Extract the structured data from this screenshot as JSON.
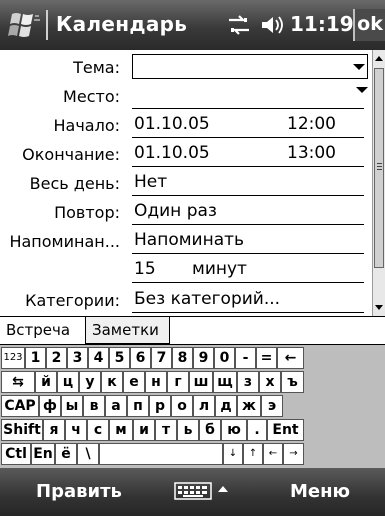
{
  "titlebar": {
    "title": "Календарь",
    "time": "11:19",
    "ok_label": "ok",
    "icons": [
      "windows-start-icon",
      "connectivity-icon",
      "volume-icon"
    ]
  },
  "form": {
    "subject": {
      "label": "Тема:",
      "value": ""
    },
    "location": {
      "label": "Место:",
      "value": ""
    },
    "starts": {
      "label": "Начало:",
      "date": "01.10.05",
      "time": "12:00"
    },
    "ends": {
      "label": "Окончание:",
      "date": "01.10.05",
      "time": "13:00"
    },
    "all_day": {
      "label": "Весь день:",
      "value": "Нет"
    },
    "occurs": {
      "label": "Повтор:",
      "value": "Один раз"
    },
    "reminder": {
      "label": "Напоминан...",
      "value": "Напоминать"
    },
    "reminder_time": {
      "amount": "15",
      "unit": "минут"
    },
    "categories": {
      "label": "Категории:",
      "value": "Без категорий..."
    }
  },
  "tabs": [
    {
      "label": "Встреча",
      "active": true
    },
    {
      "label": "Заметки",
      "active": false
    }
  ],
  "keyboard": {
    "rows": [
      [
        "123",
        "1",
        "2",
        "3",
        "4",
        "5",
        "6",
        "7",
        "8",
        "9",
        "0",
        "-",
        "=",
        "←"
      ],
      [
        "⇆",
        "й",
        "ц",
        "у",
        "к",
        "е",
        "н",
        "г",
        "ш",
        "щ",
        "з",
        "х",
        "ъ"
      ],
      [
        "CAP",
        "ф",
        "ы",
        "в",
        "а",
        "п",
        "р",
        "о",
        "л",
        "д",
        "ж",
        "э"
      ],
      [
        "Shift",
        "я",
        "ч",
        "с",
        "м",
        "и",
        "т",
        "ь",
        "б",
        "ю",
        ".",
        "Ent"
      ],
      [
        "Ctl",
        "En",
        "ё",
        "\\",
        "",
        "↓",
        "↑",
        "←",
        "→"
      ]
    ]
  },
  "menubar": {
    "left_label": "Править",
    "right_label": "Меню"
  }
}
